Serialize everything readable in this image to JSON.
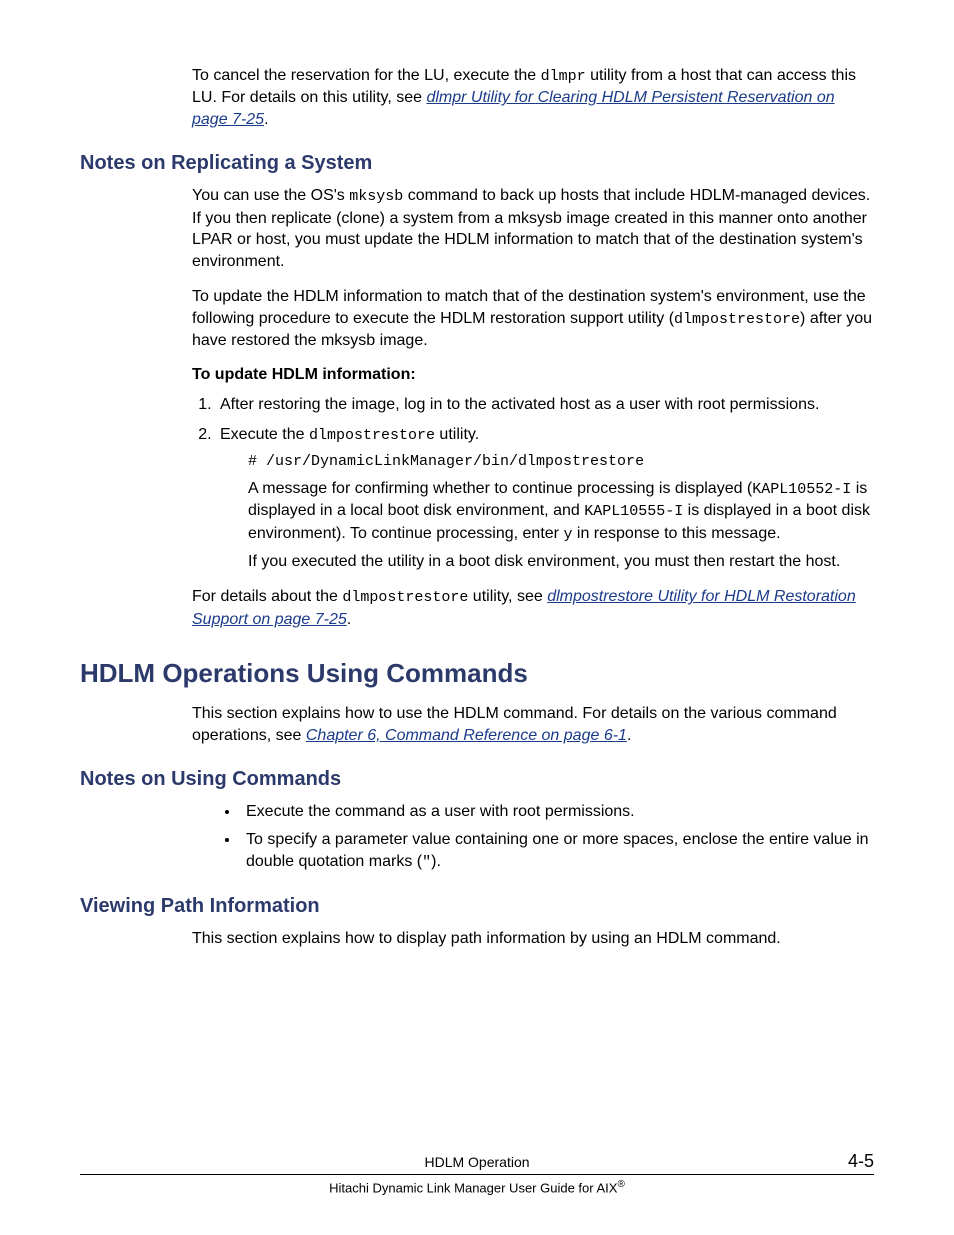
{
  "intro": {
    "p1_a": "To cancel the reservation for the LU, execute the ",
    "p1_code": "dlmpr",
    "p1_b": " utility from a host that can access this LU. For details on this utility, see ",
    "p1_link": "dlmpr Utility for Clearing HDLM Persistent Reservation on page 7-25",
    "p1_c": "."
  },
  "section1": {
    "heading": "Notes on Replicating a System",
    "p1_a": "You can use the OS's ",
    "p1_code": "mksysb",
    "p1_b": " command to back up hosts that include HDLM-managed devices. If you then replicate (clone) a system from a mksysb image created in this manner onto another LPAR or host, you must update the HDLM information to match that of the destination system's environment.",
    "p2_a": "To update the HDLM information to match that of the destination system's environment, use the following procedure to execute the HDLM restoration support utility (",
    "p2_code": "dlmpostrestore",
    "p2_b": ") after you have restored the mksysb image.",
    "subhead": "To update HDLM information:",
    "li1": "After restoring the image, log in to the activated host as a user with root permissions.",
    "li2_a": "Execute the ",
    "li2_code": "dlmpostrestore",
    "li2_b": " utility.",
    "cmd": "# /usr/DynamicLinkManager/bin/dlmpostrestore",
    "msg_a": "A message for confirming whether to continue processing is displayed (",
    "msg_code1": "KAPL10552-I",
    "msg_b": " is displayed in a local boot disk environment, and ",
    "msg_code2": "KAPL10555-I",
    "msg_c": " is displayed in a boot disk environment). To continue processing, enter ",
    "msg_code3": "y",
    "msg_d": " in response to this message.",
    "note": "If you executed the utility in a boot disk environment, you must then restart the host.",
    "tail_a": "For details about the ",
    "tail_code": "dlmpostrestore",
    "tail_b": " utility, see ",
    "tail_link": "dlmpostrestore Utility for HDLM Restoration Support on page 7-25",
    "tail_c": "."
  },
  "section2": {
    "heading": "HDLM Operations Using Commands",
    "p1_a": "This section explains how to use the HDLM command. For details on the various command operations, see ",
    "p1_link": "Chapter 6, Command Reference on page 6-1",
    "p1_b": "."
  },
  "section3": {
    "heading": "Notes on Using Commands",
    "li1": "Execute the command as a user with root permissions.",
    "li2_a": "To specify a parameter value containing one or more spaces, enclose the entire value in double quotation marks (",
    "li2_code": "\"",
    "li2_b": ")."
  },
  "section4": {
    "heading": "Viewing Path Information",
    "p1": "This section explains how to display path information by using an HDLM command."
  },
  "footer": {
    "chapter": "HDLM Operation",
    "page": "4-5",
    "book_a": "Hitachi Dynamic Link Manager User Guide for AIX",
    "book_reg": "®"
  }
}
